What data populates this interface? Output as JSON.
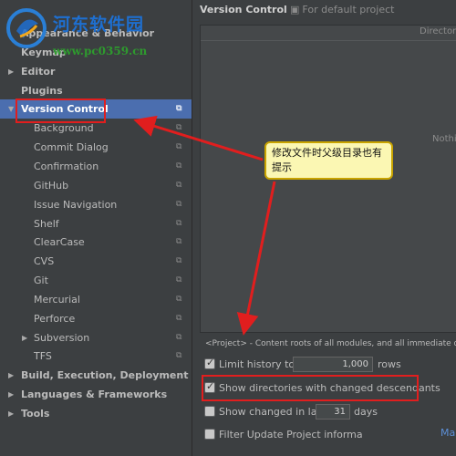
{
  "sidebar": {
    "items": [
      {
        "label": "Appearance & Behavior",
        "bold": true,
        "arrow": "",
        "copy": false
      },
      {
        "label": "Keymap",
        "bold": true,
        "arrow": "",
        "copy": false
      },
      {
        "label": "Editor",
        "bold": true,
        "arrow": "▶",
        "copy": false
      },
      {
        "label": "Plugins",
        "bold": true,
        "arrow": "",
        "copy": false
      },
      {
        "label": "Version Control",
        "bold": true,
        "arrow": "▼",
        "copy": true,
        "selected": true
      },
      {
        "label": "Background",
        "bold": false,
        "arrow": "",
        "copy": true
      },
      {
        "label": "Commit Dialog",
        "bold": false,
        "arrow": "",
        "copy": true
      },
      {
        "label": "Confirmation",
        "bold": false,
        "arrow": "",
        "copy": true
      },
      {
        "label": "GitHub",
        "bold": false,
        "arrow": "",
        "copy": true
      },
      {
        "label": "Issue Navigation",
        "bold": false,
        "arrow": "",
        "copy": true
      },
      {
        "label": "Shelf",
        "bold": false,
        "arrow": "",
        "copy": true
      },
      {
        "label": "ClearCase",
        "bold": false,
        "arrow": "",
        "copy": true
      },
      {
        "label": "CVS",
        "bold": false,
        "arrow": "",
        "copy": true
      },
      {
        "label": "Git",
        "bold": false,
        "arrow": "",
        "copy": true
      },
      {
        "label": "Mercurial",
        "bold": false,
        "arrow": "",
        "copy": true
      },
      {
        "label": "Perforce",
        "bold": false,
        "arrow": "",
        "copy": true
      },
      {
        "label": "Subversion",
        "bold": false,
        "arrow": "▶",
        "copy": true
      },
      {
        "label": "TFS",
        "bold": false,
        "arrow": "",
        "copy": true
      },
      {
        "label": "Build, Execution, Deployment",
        "bold": true,
        "arrow": "▶",
        "copy": false
      },
      {
        "label": "Languages & Frameworks",
        "bold": true,
        "arrow": "▶",
        "copy": false
      },
      {
        "label": "Tools",
        "bold": true,
        "arrow": "▶",
        "copy": false
      }
    ]
  },
  "header": {
    "title": "Version Control",
    "subtitle": "For default project",
    "subtitle_icon": "project-icon"
  },
  "table": {
    "column_header": "Director",
    "empty_text": "Nothi"
  },
  "note": "<Project> - Content roots of all modules, and all immediate des",
  "options": {
    "limit_history": {
      "label": "Limit history to:",
      "checked": true,
      "value": "1,000",
      "suffix": "rows"
    },
    "show_directories": {
      "label": "Show directories with changed descendants",
      "checked": true
    },
    "show_changed": {
      "label": "Show changed in last",
      "checked": false,
      "value": "31",
      "suffix": "days"
    },
    "filter_update": {
      "label": "Filter Update Project informa",
      "checked": false
    }
  },
  "link_text": "Ma",
  "callout_text": "修改文件时父级目录也有提示",
  "watermark": {
    "title": "河东软件园",
    "url": "www.pc0359.cn"
  },
  "colors": {
    "accent_selection": "#4b6eaf",
    "annotation_red": "#e11e1e",
    "callout_bg": "#fbf7b3"
  }
}
